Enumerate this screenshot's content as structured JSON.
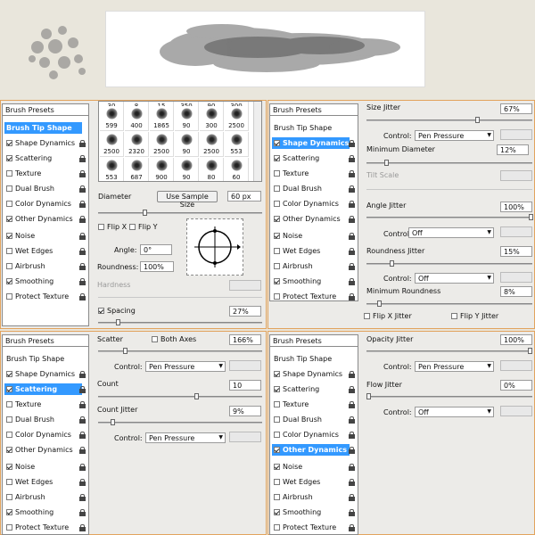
{
  "presets": {
    "header": "Brush Presets",
    "tip": "Brush Tip Shape",
    "items": [
      "Shape Dynamics",
      "Scattering",
      "Texture",
      "Dual Brush",
      "Color Dynamics",
      "Other Dynamics",
      "Noise",
      "Wet Edges",
      "Airbrush",
      "Smoothing",
      "Protect Texture"
    ]
  },
  "tip_panel": {
    "sizes_row1": [
      "599",
      "400",
      "1865",
      "90",
      "300",
      "2500"
    ],
    "sizes_row2": [
      "2500",
      "2320",
      "2500",
      "90",
      "2500",
      "553"
    ],
    "sizes_row3": [
      "553",
      "687",
      "900",
      "90",
      "80",
      "60"
    ],
    "top_partial": [
      "30",
      "8",
      "15",
      "350",
      "90",
      "300"
    ],
    "diameter_label": "Diameter",
    "use_sample": "Use Sample Size",
    "diameter_value": "60 px",
    "flip_x": "Flip X",
    "flip_y": "Flip Y",
    "angle_label": "Angle:",
    "angle_value": "0°",
    "roundness_label": "Roundness:",
    "roundness_value": "100%",
    "hardness_label": "Hardness",
    "spacing_label": "Spacing",
    "spacing_value": "27%"
  },
  "shape_panel": {
    "size_jitter": "Size Jitter",
    "size_jitter_value": "67%",
    "control": "Control:",
    "pen_pressure": "Pen Pressure",
    "min_diameter": "Minimum Diameter",
    "min_diameter_value": "12%",
    "tilt_scale": "Tilt Scale",
    "angle_jitter": "Angle Jitter",
    "angle_jitter_value": "100%",
    "off": "Off",
    "roundness_jitter": "Roundness Jitter",
    "roundness_jitter_value": "15%",
    "min_roundness": "Minimum Roundness",
    "min_roundness_value": "8%",
    "flip_x_jitter": "Flip X Jitter",
    "flip_y_jitter": "Flip Y Jitter"
  },
  "scatter_panel": {
    "scatter": "Scatter",
    "both_axes": "Both Axes",
    "scatter_value": "166%",
    "control": "Control:",
    "pen_pressure": "Pen Pressure",
    "count": "Count",
    "count_value": "10",
    "count_jitter": "Count Jitter",
    "count_jitter_value": "9%"
  },
  "other_panel": {
    "opacity_jitter": "Opacity Jitter",
    "opacity_jitter_value": "100%",
    "control": "Control:",
    "pen_pressure": "Pen Pressure",
    "flow_jitter": "Flow Jitter",
    "flow_jitter_value": "0%",
    "off": "Off"
  }
}
